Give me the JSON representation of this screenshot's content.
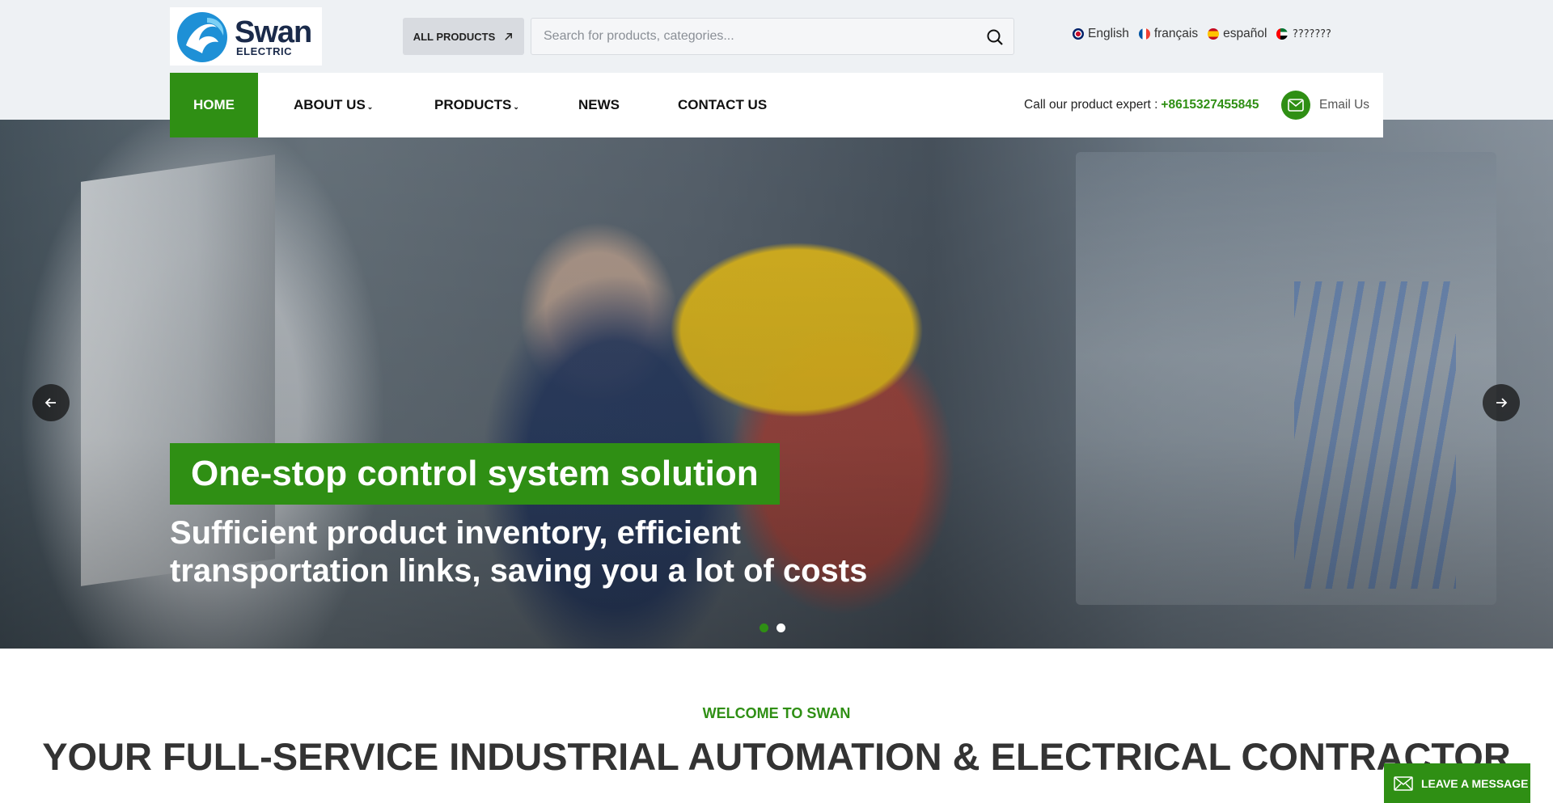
{
  "brand": {
    "name": "Swan",
    "subtitle": "ELECTRIC"
  },
  "header": {
    "all_products_label": "ALL PRODUCTS",
    "search_placeholder": "Search for products, categories...",
    "languages": [
      {
        "label": "English",
        "flag": "uk-flag-icon"
      },
      {
        "label": "français",
        "flag": "france-flag-icon"
      },
      {
        "label": "español",
        "flag": "spain-flag-icon"
      },
      {
        "label": "???????",
        "flag": "arabic-flag-icon"
      }
    ]
  },
  "nav": {
    "items": [
      {
        "label": "HOME",
        "active": true
      },
      {
        "label": "ABOUT US",
        "dropdown": true
      },
      {
        "label": "PRODUCTS",
        "dropdown": true
      },
      {
        "label": "NEWS"
      },
      {
        "label": "CONTACT US"
      }
    ],
    "contact_prefix": "Call our product expert :",
    "phone": "+8615327455845",
    "email_label": "Email Us"
  },
  "hero": {
    "title": "One-stop control system solution",
    "subtitle": "Sufficient product inventory, efficient transportation links, saving you a lot of costs",
    "slides": 2,
    "active_slide": 1
  },
  "welcome": {
    "kicker": "WELCOME TO SWAN",
    "title": "YOUR FULL-SERVICE INDUSTRIAL AUTOMATION & ELECTRICAL CONTRACTOR"
  },
  "widget": {
    "leave_message_label": "LEAVE A MESSAGE"
  },
  "colors": {
    "accent": "#2f8f14",
    "background": "#eef1f4"
  }
}
